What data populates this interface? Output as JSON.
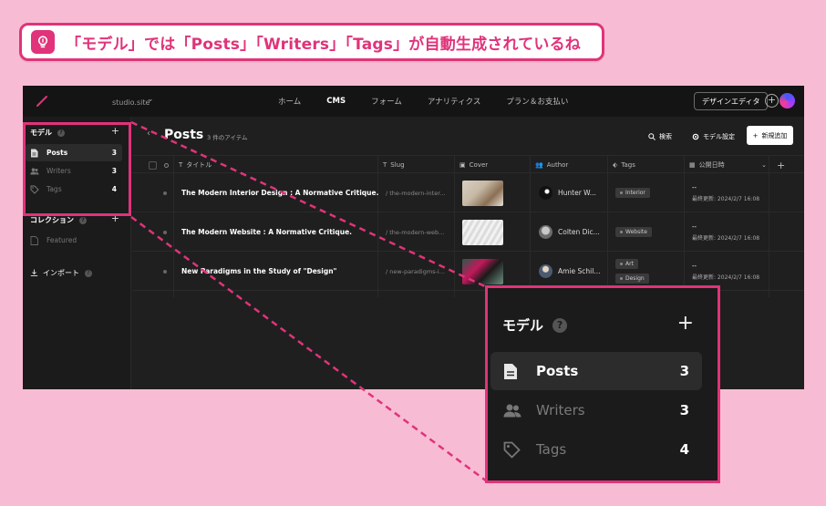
{
  "callout": {
    "text": "「モデル」では「Posts」「Writers」「Tags」が自動生成されているね"
  },
  "topbar": {
    "site_name": "studio.site",
    "nav": [
      "ホーム",
      "CMS",
      "フォーム",
      "アナリティクス",
      "プラン＆お支払い"
    ],
    "active_nav": "CMS",
    "design_editor": "デザインエディタ"
  },
  "sidebar": {
    "models_title": "モデル",
    "models": [
      {
        "label": "Posts",
        "count": "3",
        "icon": "document-icon"
      },
      {
        "label": "Writers",
        "count": "3",
        "icon": "people-icon"
      },
      {
        "label": "Tags",
        "count": "4",
        "icon": "tag-icon"
      }
    ],
    "collections_title": "コレクション",
    "collections": [
      {
        "label": "Featured",
        "icon": "document-icon"
      }
    ],
    "import_label": "インポート"
  },
  "content": {
    "title": "Posts",
    "count": "3 件のアイテム",
    "search": "検索",
    "model_settings": "モデル設定",
    "new_button": "新規追加"
  },
  "table": {
    "columns": [
      "タイトル",
      "Slug",
      "Cover",
      "Author",
      "Tags",
      "公開日時"
    ],
    "rows": [
      {
        "title": "The Modern Interior Design : A Normative Critique.",
        "slug": "/ the-modern-inter...",
        "author": "Hunter W...",
        "tags": [
          "Interior"
        ],
        "date": "--",
        "updated": "最終更新: 2024/2/7 16:08"
      },
      {
        "title": "The Modern Website : A Normative Critique.",
        "slug": "/ the-modern-web...",
        "author": "Colten Dic...",
        "tags": [
          "Website"
        ],
        "date": "--",
        "updated": "最終更新: 2024/2/7 16:08"
      },
      {
        "title": "New Paradigms in the Study of \"Design\"",
        "slug": "/ new-paradigms-i...",
        "author": "Amie Schil...",
        "tags": [
          "Art",
          "Design"
        ],
        "date": "--",
        "updated": "最終更新: 2024/2/7 16:08"
      }
    ]
  },
  "colors": {
    "accent": "#e0337a",
    "background": "#f7bcd3",
    "app_bg": "#1f1f1f"
  }
}
